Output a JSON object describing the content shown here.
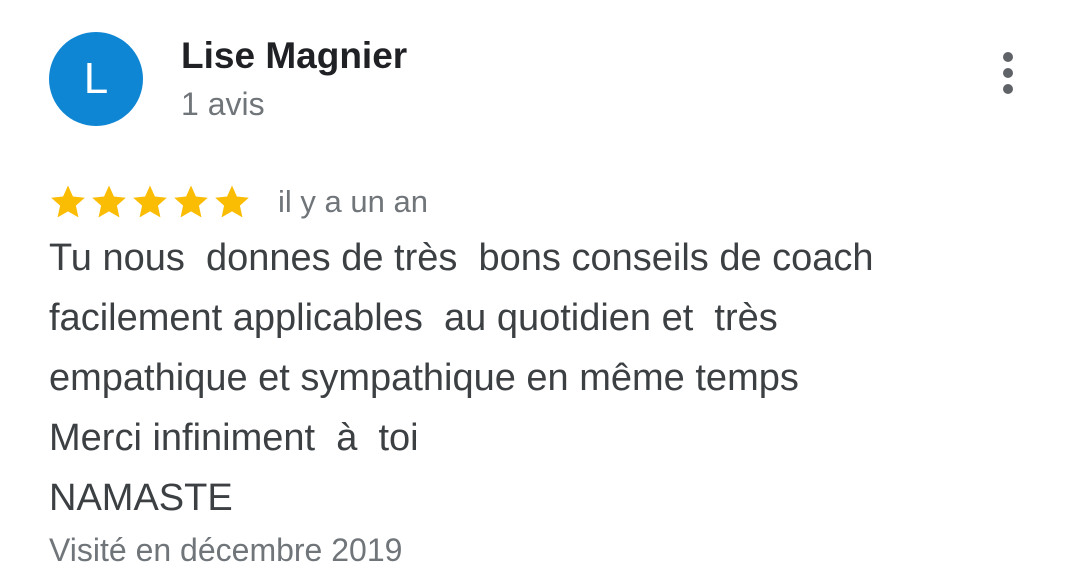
{
  "reviewer": {
    "avatar_letter": "L",
    "avatar_color": "#0e86d4",
    "name": "Lise Magnier",
    "review_count": "1 avis"
  },
  "menu": {
    "icon": "more-vert-icon"
  },
  "review": {
    "rating": 5,
    "rating_max": 5,
    "star_color": "#fbbc04",
    "date": "il y a un an",
    "lines": [
      "Tu nous  donnes de très  bons conseils de coach",
      "facilement applicables  au quotidien et  très",
      "empathique et sympathique en même temps",
      "Merci infiniment  à  toi",
      "NAMASTE"
    ],
    "visit": "Visité en décembre 2019"
  }
}
